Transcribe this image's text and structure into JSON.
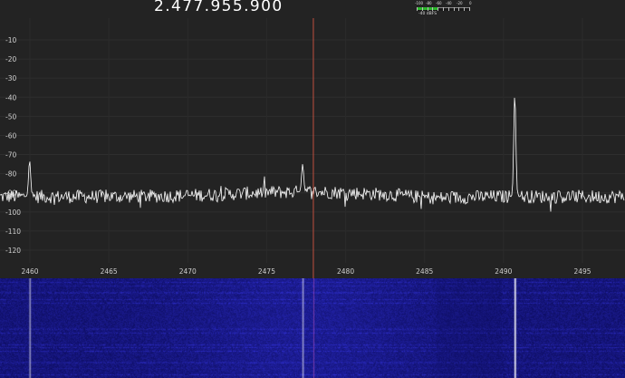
{
  "app": {
    "frequency_readout": "2.477.955.900",
    "signal_meter": {
      "scale_labels": [
        "-100",
        "-80",
        "-60",
        "-40",
        "-20",
        "0"
      ],
      "value_label": "-40 dBFS",
      "level_dbfs": -60
    }
  },
  "spectrum": {
    "y_axis": {
      "min": -130,
      "max": 0,
      "ticks": [
        -10,
        -20,
        -30,
        -40,
        -50,
        -60,
        -70,
        -80,
        -90,
        -100,
        -110,
        -120
      ]
    },
    "x_axis": {
      "min": 2459.5,
      "max": 2497.5,
      "unit": "MHz",
      "ticks": [
        2460,
        2465,
        2470,
        2475,
        2480,
        2485,
        2490,
        2495
      ]
    },
    "tuned_frequency_mhz": 2477.956,
    "noise_floor_db": -92,
    "peaks": [
      {
        "frequency_mhz": 2461.3,
        "level_db": -73
      },
      {
        "frequency_mhz": 2477.9,
        "level_db": -75
      },
      {
        "frequency_mhz": 2490.8,
        "level_db": -38
      }
    ]
  },
  "colors": {
    "background": "#232323",
    "trace": "#ffffff",
    "tuning_line": "#c0503f",
    "waterfall_base": "#14147a",
    "meter_fill": "#2bb52b"
  }
}
